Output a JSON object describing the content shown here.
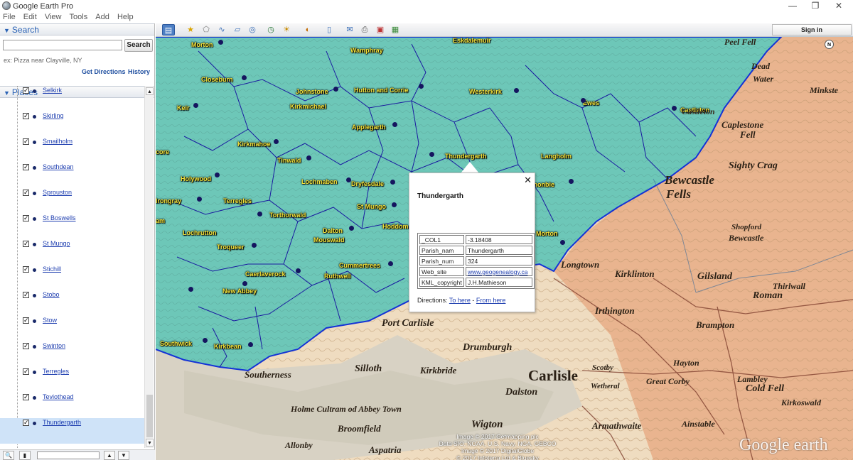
{
  "window": {
    "title": "Google Earth Pro",
    "minimize": "—",
    "restore": "❐",
    "close": "✕"
  },
  "menu": [
    "File",
    "Edit",
    "View",
    "Tools",
    "Add",
    "Help"
  ],
  "search": {
    "header": "Search",
    "placeholder": "",
    "button": "Search",
    "hint": "ex: Pizza near Clayville, NY",
    "get_directions": "Get Directions",
    "history": "History"
  },
  "places": {
    "header": "Places",
    "items": [
      {
        "label": "Selkirk",
        "checked": true
      },
      {
        "label": "Skirling",
        "checked": true
      },
      {
        "label": "Smailholm",
        "checked": true
      },
      {
        "label": "Southdean",
        "checked": true
      },
      {
        "label": "Sprouston",
        "checked": true
      },
      {
        "label": "St Boswells",
        "checked": true
      },
      {
        "label": "St Mungo",
        "checked": true
      },
      {
        "label": "Stichill",
        "checked": true
      },
      {
        "label": "Stobo",
        "checked": true
      },
      {
        "label": "Stow",
        "checked": true
      },
      {
        "label": "Swinton",
        "checked": true
      },
      {
        "label": "Terregles",
        "checked": true
      },
      {
        "label": "Teviothead",
        "checked": true
      },
      {
        "label": "Thundergarth",
        "checked": true,
        "selected": true
      }
    ]
  },
  "toolbar": {
    "signin": "Sign in"
  },
  "map": {
    "parish_labels": [
      "Morton",
      "Wamphray",
      "Eskdalemuir",
      "Closeburn",
      "Johnstone",
      "Hutton and Corrie",
      "Westerkirk",
      "Ewes",
      "Castleton",
      "Keir",
      "Kirkmichael",
      "Applegarth",
      "Kirkmahoe",
      "Tinwald",
      "Thundergarth",
      "Langholm",
      "Holywood",
      "Lochmaben",
      "Dryfesdale",
      "Canonbie",
      "Terregles",
      "St Mungo",
      "Torthorwald",
      "Hoddom",
      "Lochrutton",
      "Dalton",
      "Mouswald",
      "Troqueer",
      "Cummertrees",
      "Caerlaverock",
      "Ruthwell",
      "New Abbey",
      "Kirkbean",
      "Irongray",
      "Southwick",
      "core",
      "am",
      "Morton"
    ],
    "old_map_labels": [
      "Bewcastle",
      "Fells",
      "Sighty Crag",
      "Shopford",
      "Bewcastle",
      "Kirklinton",
      "Gilsland",
      "Longtown",
      "Irthington",
      "Roman",
      "Brampton",
      "Port Carlisle",
      "Drumburgh",
      "Carlisle",
      "Dalston",
      "Southerness",
      "Silloth",
      "Kirkbride",
      "Wigton",
      "Broomfield",
      "Holme Cultram od Abbey Town",
      "Aspatria",
      "Allonby",
      "Armathwaite",
      "Ainstable",
      "Cold Fell",
      "Great Corby",
      "Hayton",
      "Kirkoswald",
      "Scotby",
      "Wetheral",
      "Lambley",
      "Thirlwall",
      "Castleton",
      "Caplestone",
      "Fell",
      "Peel Fell",
      "Dead",
      "Water",
      "Minkste"
    ],
    "credits": [
      "Image © 2017 Getmapping plc",
      "Data SIO, NOAA, U.S. Navy, NGA, GEBCO",
      "Image © 2017 DigitalGlobe",
      "© 2017 Infoterra Ltd & Bluesky"
    ],
    "logo": "Google earth",
    "compass": "N"
  },
  "balloon": {
    "title": "Thundergarth",
    "close": "✕",
    "rows": [
      {
        "key": "_COL1",
        "value": "-3.18408"
      },
      {
        "key": "Parish_nam",
        "value": "Thundergarth"
      },
      {
        "key": "Parish_num",
        "value": "324"
      },
      {
        "key": "Web_site",
        "value": "www.geogenealogy.ca",
        "link": true
      },
      {
        "key": "KML_copyright",
        "value": "J.H.Mathieson"
      }
    ],
    "directions_label": "Directions:",
    "to_here": "To here",
    "separator": "-",
    "from_here": "From here"
  }
}
